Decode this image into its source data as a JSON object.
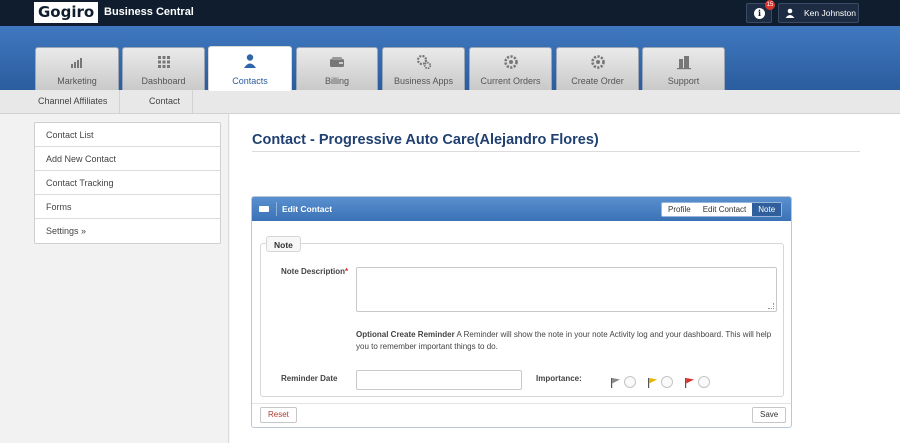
{
  "app": {
    "logo": "Gogiro",
    "title": "Business Central"
  },
  "header": {
    "notification_count": "15",
    "user_name": "Ken Johnston"
  },
  "nav_tabs": [
    {
      "label": "Marketing",
      "icon": "bar-chart-icon"
    },
    {
      "label": "Dashboard",
      "icon": "grid-icon"
    },
    {
      "label": "Contacts",
      "icon": "person-icon",
      "active": true
    },
    {
      "label": "Billing",
      "icon": "wallet-icon"
    },
    {
      "label": "Business Apps",
      "icon": "gears-icon"
    },
    {
      "label": "Current Orders",
      "icon": "gear-icon"
    },
    {
      "label": "Create Order",
      "icon": "gear-icon"
    },
    {
      "label": "Support",
      "icon": "building-icon"
    }
  ],
  "subnav": [
    "Channel Affiliates",
    "Contact"
  ],
  "sidebar": [
    "Contact List",
    "Add New Contact",
    "Contact Tracking",
    "Forms",
    "Settings  »"
  ],
  "page": {
    "title": "Contact - Progressive Auto Care(Alejandro Flores)"
  },
  "panel": {
    "title": "Edit Contact",
    "tabs": [
      {
        "label": "Profile"
      },
      {
        "label": "Edit Contact"
      },
      {
        "label": "Note",
        "active": true
      }
    ],
    "section_title": "Note",
    "note_label": "Note Description",
    "required_mark": "*",
    "note_value": "",
    "reminder_hint_bold": "Optional Create Reminder",
    "reminder_hint_text": " A Reminder will show the note in your note Activity log and your dashboard. This will help you to remember important things to do.",
    "reminder_date_label": "Reminder Date",
    "reminder_date_value": "",
    "importance_label": "Importance:",
    "importance_levels": [
      {
        "icon": "gray-flag-icon",
        "color": "#8a8a8a"
      },
      {
        "icon": "yellow-flag-icon",
        "color": "#e6b400"
      },
      {
        "icon": "red-flag-icon",
        "color": "#d9342b"
      }
    ],
    "reset_label": "Reset",
    "save_label": "Save"
  }
}
